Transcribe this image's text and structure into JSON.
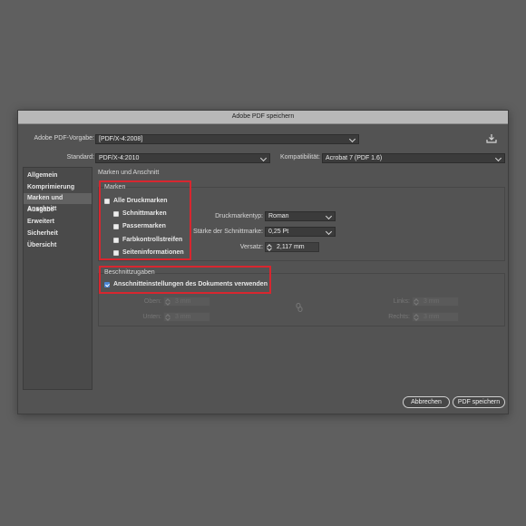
{
  "dialog": {
    "title": "Adobe PDF speichern"
  },
  "preset": {
    "label": "Adobe PDF-Vorgabe:",
    "value": "[PDF/X-4:2008]"
  },
  "standard": {
    "label": "Standard:",
    "value": "PDF/X-4:2010"
  },
  "compat": {
    "label": "Kompatibilität:",
    "value": "Acrobat 7 (PDF 1.6)"
  },
  "sidebar": {
    "items": [
      {
        "label": "Allgemein"
      },
      {
        "label": "Komprimierung"
      },
      {
        "label": "Marken und Anschnitt"
      },
      {
        "label": "Ausgabe"
      },
      {
        "label": "Erweitert"
      },
      {
        "label": "Sicherheit"
      },
      {
        "label": "Übersicht"
      }
    ],
    "active_index": 2
  },
  "section": {
    "title": "Marken und Anschnitt"
  },
  "marks": {
    "title": "Marken",
    "all_label": "Alle Druckmarken",
    "items": [
      {
        "label": "Schnittmarken",
        "checked": false
      },
      {
        "label": "Passermarken",
        "checked": false
      },
      {
        "label": "Farbkontrollstreifen",
        "checked": false
      },
      {
        "label": "Seiteninformationen",
        "checked": false
      }
    ],
    "type_label": "Druckmarkentyp:",
    "type_value": "Roman",
    "weight_label": "Stärke der Schnittmarke:",
    "weight_value": "0,25 Pt",
    "offset_label": "Versatz:",
    "offset_value": "2,117 mm"
  },
  "bleed": {
    "title": "Beschnittzugaben",
    "use_doc_label": "Anschnitteinstellungen des Dokuments verwenden",
    "use_doc_checked": true,
    "top_label": "Oben:",
    "top_value": "3 mm",
    "bottom_label": "Unten:",
    "bottom_value": "3 mm",
    "left_label": "Links:",
    "left_value": "3 mm",
    "right_label": "Rechts:",
    "right_value": "3 mm"
  },
  "buttons": {
    "cancel": "Abbrechen",
    "save": "PDF speichern"
  },
  "colors": {
    "highlight": "#d8262f",
    "accent": "#4b87d6"
  }
}
